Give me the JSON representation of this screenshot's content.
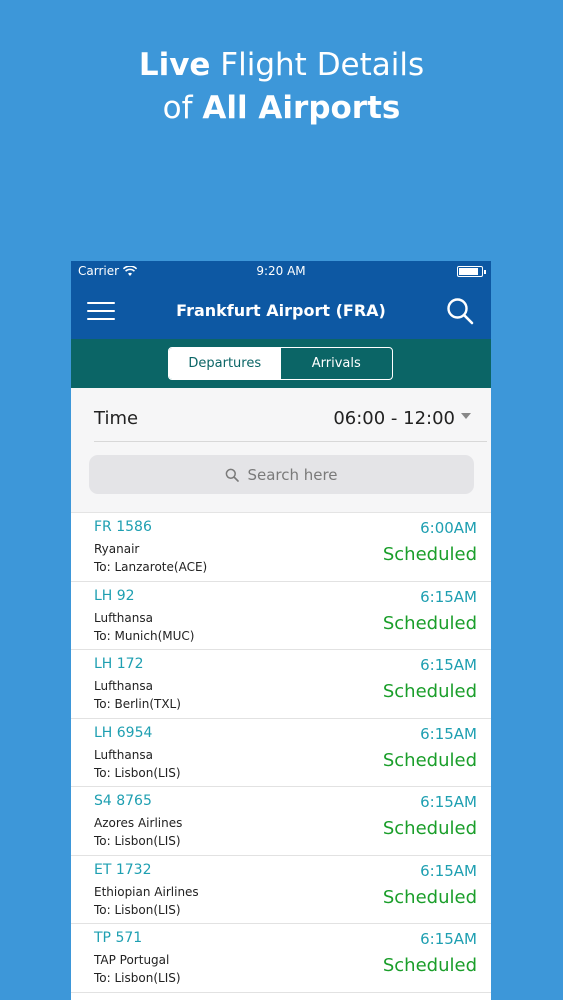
{
  "promo": {
    "line1_bold": "Live",
    "line1_light": "Flight Details",
    "line2_light": "of",
    "line2_bold": "All Airports"
  },
  "status_bar": {
    "carrier": "Carrier",
    "time": "9:20 AM"
  },
  "navbar": {
    "title": "Frankfurt Airport (FRA)"
  },
  "tabs": [
    {
      "label": "Departures",
      "active": true
    },
    {
      "label": "Arrivals",
      "active": false
    }
  ],
  "filter": {
    "time_label": "Time",
    "time_range": "06:00 - 12:00",
    "search_placeholder": "Search here"
  },
  "flights": [
    {
      "number": "FR 1586",
      "airline": "Ryanair",
      "destination": "To: Lanzarote(ACE)",
      "time": "6:00AM",
      "status": "Scheduled"
    },
    {
      "number": "LH 92",
      "airline": "Lufthansa",
      "destination": "To: Munich(MUC)",
      "time": "6:15AM",
      "status": "Scheduled"
    },
    {
      "number": "LH 172",
      "airline": "Lufthansa",
      "destination": "To: Berlin(TXL)",
      "time": "6:15AM",
      "status": "Scheduled"
    },
    {
      "number": "LH 6954",
      "airline": "Lufthansa",
      "destination": "To: Lisbon(LIS)",
      "time": "6:15AM",
      "status": "Scheduled"
    },
    {
      "number": "S4 8765",
      "airline": "Azores Airlines",
      "destination": "To: Lisbon(LIS)",
      "time": "6:15AM",
      "status": "Scheduled"
    },
    {
      "number": "ET 1732",
      "airline": "Ethiopian Airlines",
      "destination": "To: Lisbon(LIS)",
      "time": "6:15AM",
      "status": "Scheduled"
    },
    {
      "number": "TP 571",
      "airline": "TAP Portugal",
      "destination": "To: Lisbon(LIS)",
      "time": "6:15AM",
      "status": "Scheduled"
    }
  ],
  "colors": {
    "background": "#3d97d9",
    "navbar": "#0d58a3",
    "segment_bar": "#0b6566",
    "flight_number": "#1e9fb1",
    "status_scheduled": "#1a9e2a"
  },
  "icons": {
    "menu": "hamburger-icon",
    "search": "search-icon",
    "wifi": "wifi-icon",
    "battery": "battery-icon",
    "dropdown": "caret-down-icon"
  }
}
